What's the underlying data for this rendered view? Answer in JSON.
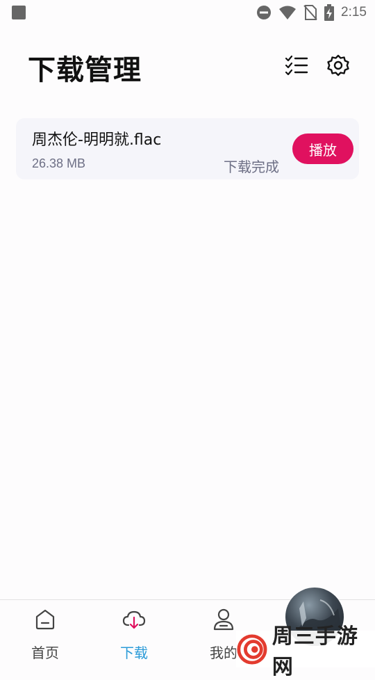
{
  "status_bar": {
    "time": "2:15",
    "icons": [
      "dnd-icon",
      "wifi-icon",
      "no-sim-icon",
      "battery-charging-icon"
    ]
  },
  "header": {
    "title": "下载管理",
    "actions": [
      "checklist-icon",
      "gear-icon"
    ]
  },
  "downloads": [
    {
      "name": "周杰伦-明明就.flac",
      "size": "26.38 MB",
      "status": "下载完成",
      "action_label": "播放"
    }
  ],
  "bottom_nav": {
    "items": [
      {
        "label": "首页",
        "icon": "home-icon",
        "active": false
      },
      {
        "label": "下载",
        "icon": "cloud-download-icon",
        "active": true
      },
      {
        "label": "我的",
        "icon": "user-icon",
        "active": false
      }
    ]
  },
  "watermark": {
    "text": "周三手游网"
  },
  "colors": {
    "accent": "#e0115f",
    "nav_active": "#2b9bd8",
    "card_bg": "#f5f5fa",
    "secondary_text": "#6d6f85"
  }
}
